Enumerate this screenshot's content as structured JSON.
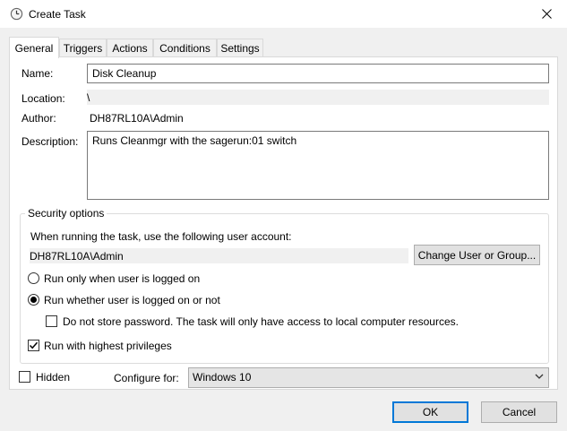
{
  "window": {
    "title": "Create Task"
  },
  "tabs": [
    {
      "label": "General",
      "active": true
    },
    {
      "label": "Triggers",
      "active": false
    },
    {
      "label": "Actions",
      "active": false
    },
    {
      "label": "Conditions",
      "active": false
    },
    {
      "label": "Settings",
      "active": false
    }
  ],
  "general": {
    "name_label": "Name:",
    "name_value": "Disk Cleanup",
    "location_label": "Location:",
    "location_value": "\\",
    "author_label": "Author:",
    "author_value": "DH87RL10A\\Admin",
    "description_label": "Description:",
    "description_value": "Runs Cleanmgr with the sagerun:01 switch"
  },
  "security": {
    "title": "Security options",
    "account_prompt": "When running the task, use the following user account:",
    "account_value": "DH87RL10A\\Admin",
    "change_button": "Change User or Group...",
    "radio_logged_on": "Run only when user is logged on",
    "radio_logged_on_checked": false,
    "radio_whether": "Run whether user is logged on or not",
    "radio_whether_checked": true,
    "no_store_password": "Do not store password.  The task will only have access to local computer resources.",
    "no_store_password_checked": false,
    "highest_privileges": "Run with highest privileges",
    "highest_privileges_checked": true
  },
  "bottom": {
    "hidden_label": "Hidden",
    "hidden_checked": false,
    "configure_label": "Configure for:",
    "configure_value": "Windows 10"
  },
  "buttons": {
    "ok": "OK",
    "cancel": "Cancel"
  },
  "icons": {
    "title": "clock-icon",
    "close": "close-icon",
    "dropdown": "chevron-down-icon"
  },
  "colors": {
    "accent": "#0078d7",
    "check": "#000000"
  }
}
